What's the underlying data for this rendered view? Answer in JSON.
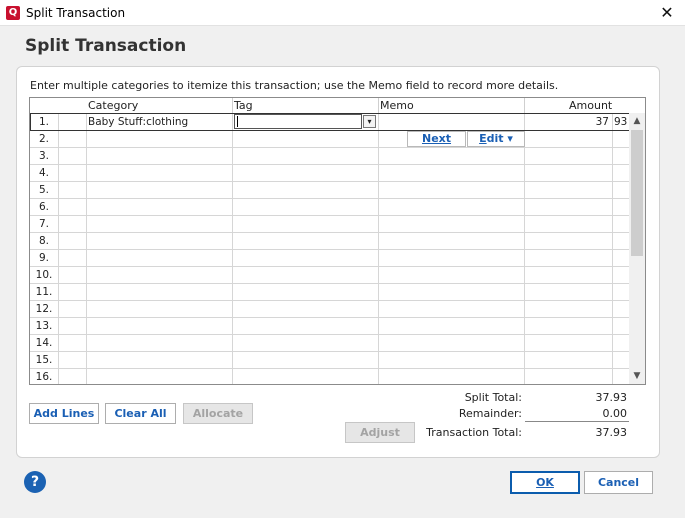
{
  "window": {
    "title": "Split Transaction",
    "app_icon": "Q",
    "close": "✕"
  },
  "page_title": "Split Transaction",
  "instructions": "Enter multiple categories to itemize this transaction; use the Memo field to record more details.",
  "columns": {
    "category": "Category",
    "tag": "Tag",
    "memo": "Memo",
    "amount": "Amount"
  },
  "rows": [
    {
      "num": "1.",
      "category": "Baby Stuff:clothing",
      "amount_int": "37",
      "amount_dec": "93"
    },
    {
      "num": "2."
    },
    {
      "num": "3."
    },
    {
      "num": "4."
    },
    {
      "num": "5."
    },
    {
      "num": "6."
    },
    {
      "num": "7."
    },
    {
      "num": "8."
    },
    {
      "num": "9."
    },
    {
      "num": "10."
    },
    {
      "num": "11."
    },
    {
      "num": "12."
    },
    {
      "num": "13."
    },
    {
      "num": "14."
    },
    {
      "num": "15."
    },
    {
      "num": "16."
    }
  ],
  "inline": {
    "next": "Next",
    "edit_prefix": "E",
    "edit_rest": "dit",
    "edit_arrow": "▾"
  },
  "buttons": {
    "add_lines": "Add Lines",
    "clear_all": "Clear All",
    "allocate": "Allocate",
    "adjust": "Adjust",
    "ok": "OK",
    "cancel": "Cancel"
  },
  "totals": {
    "split_total_label": "Split Total:",
    "split_total": "37.93",
    "remainder_label": "Remainder:",
    "remainder": "0.00",
    "transaction_total_label": "Transaction Total:",
    "transaction_total": "37.93"
  },
  "help": "?",
  "icons": {
    "scroll_up": "chevron-up-icon",
    "scroll_down": "chevron-down-icon",
    "tag_dropdown": "dropdown-icon"
  },
  "colors": {
    "link_blue": "#1a5fb4",
    "quicken_red": "#c8102e",
    "help_blue": "#1b62b3"
  }
}
